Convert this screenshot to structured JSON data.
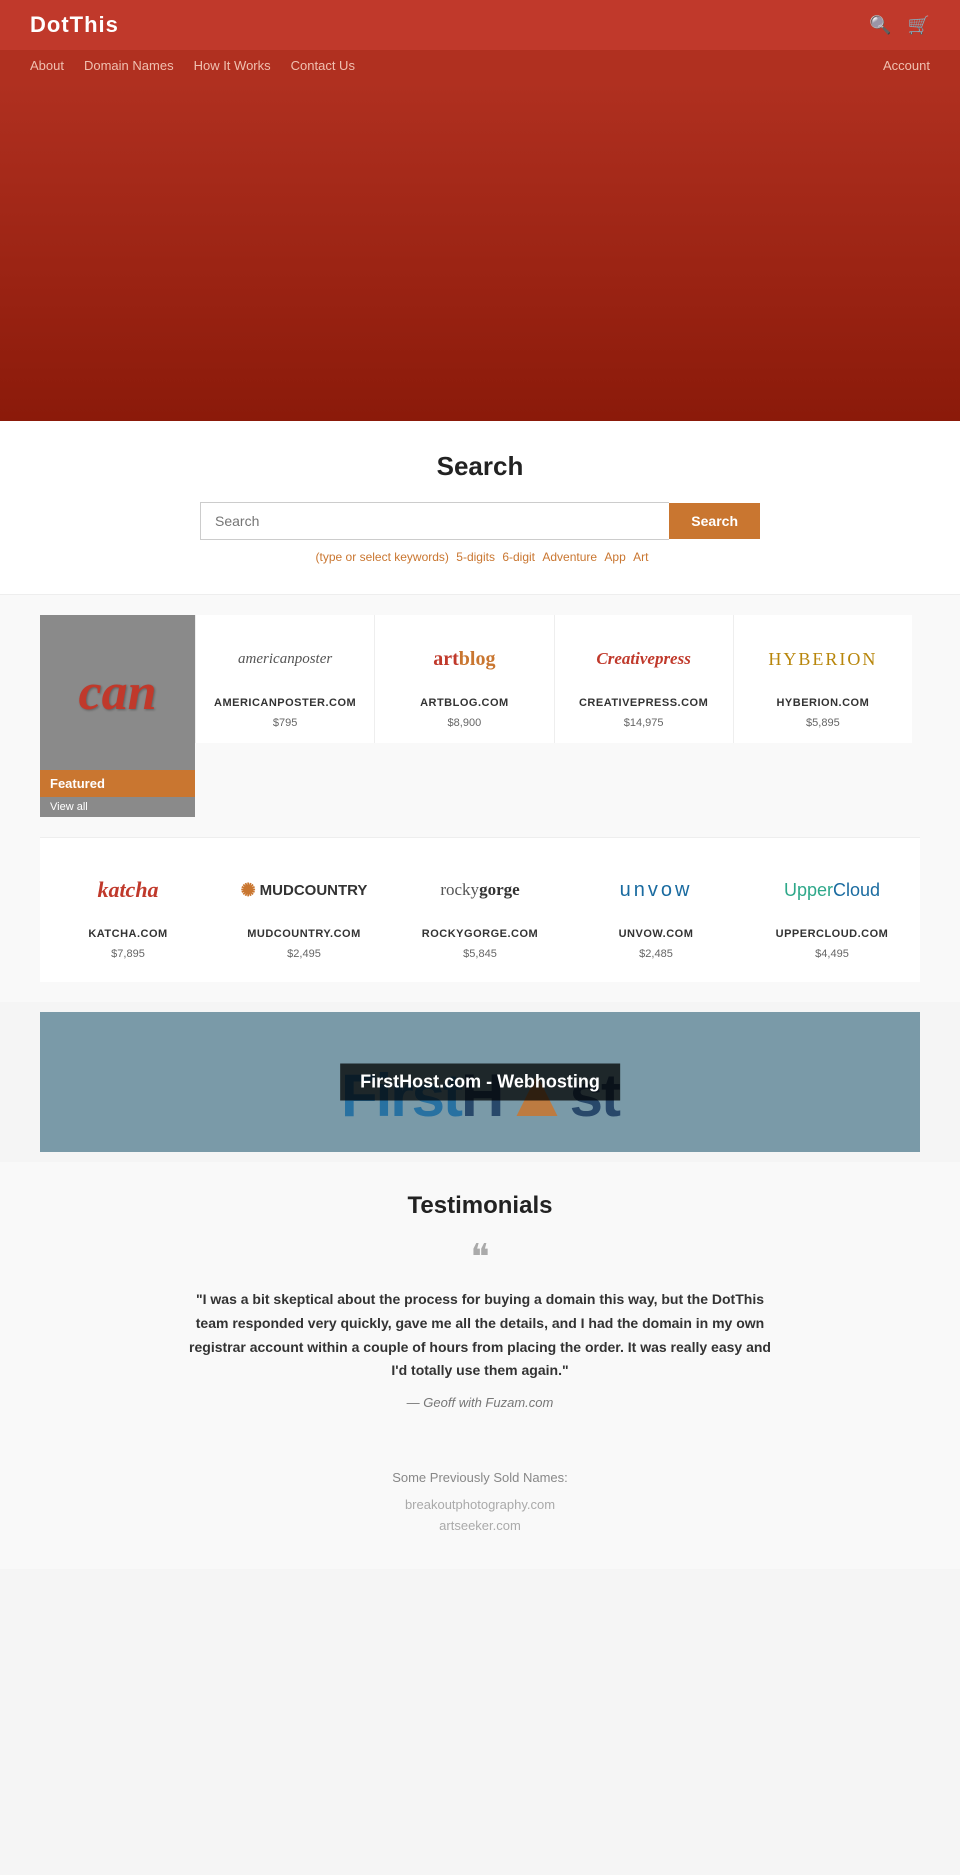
{
  "header": {
    "logo": "DotThis",
    "nav": {
      "about": "About",
      "domainNames": "Domain Names",
      "howItWorks": "How It Works",
      "contactUs": "Contact Us",
      "account": "Account"
    }
  },
  "search": {
    "title": "Search",
    "placeholder": "Search",
    "button": "Search",
    "hint": "(type or select keywords)",
    "keywords": [
      "5-digits",
      "6-digit",
      "Adventure",
      "App",
      "Art"
    ]
  },
  "featured": {
    "label": "Featured",
    "viewAll": "View all",
    "canText": "can",
    "domains": [
      {
        "name": "AMERICANPOSTER.COM",
        "price": "$795",
        "logoClass": "logo-americanposter",
        "logoText": "americanposter"
      },
      {
        "name": "ARTBLOG.COM",
        "price": "$8,900",
        "logoClass": "logo-artblog",
        "logoText": "artblog"
      },
      {
        "name": "CREATIVEPRESS.COM",
        "price": "$14,975",
        "logoClass": "logo-creativepress",
        "logoText": "Creativepress"
      },
      {
        "name": "HYBERION.COM",
        "price": "$5,895",
        "logoClass": "logo-hyberion",
        "logoText": "HYBERION"
      }
    ]
  },
  "secondRow": {
    "domains": [
      {
        "name": "KATCHA.COM",
        "price": "$7,895",
        "logoClass": "logo-katcha",
        "logoText": "katcha"
      },
      {
        "name": "MUDCOUNTRY.COM",
        "price": "$2,495",
        "logoClass": "logo-mudcountry",
        "logoText": "MUDCOUNTRY"
      },
      {
        "name": "ROCKYGORGE.COM",
        "price": "$5,845",
        "logoClass": "logo-rockygorge",
        "logoText": "rockygorge"
      },
      {
        "name": "UNVOW.COM",
        "price": "$2,485",
        "logoClass": "logo-unvow",
        "logoText": "unvow"
      },
      {
        "name": "UPPERCLOUD.COM",
        "price": "$4,495",
        "logoClass": "logo-uppercloud",
        "logoText": "UpperCloud"
      }
    ]
  },
  "adBanner": {
    "title": "FirstHost.com - Webhosting",
    "bgText": "FirstHost"
  },
  "testimonials": {
    "title": "Testimonials",
    "quote": "\"I was a bit skeptical about the process for buying a domain this way, but the DotThis team responded very quickly, gave me all the details, and I had the domain in my own registrar account within a couple of hours from placing the order. It was really easy and I'd totally use them again.\"",
    "author": "— Geoff with Fuzam.com"
  },
  "soldSection": {
    "title": "Some Previously Sold Names:",
    "items": [
      "breakoutphotography.com",
      "artseeker.com"
    ]
  }
}
